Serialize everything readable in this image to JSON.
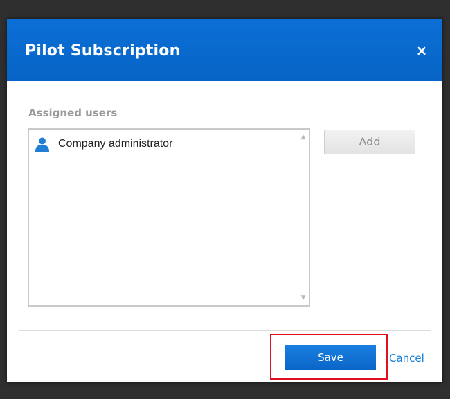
{
  "dialog": {
    "title": "Pilot Subscription",
    "close_icon": "close-icon",
    "close_glyph": "×",
    "header_color": "#0a6bd0"
  },
  "assigned_users": {
    "label": "Assigned users",
    "items": [
      {
        "label": "Company administrator",
        "icon": "user-icon"
      }
    ],
    "scroll_up_glyph": "▲",
    "scroll_down_glyph": "▼"
  },
  "actions": {
    "add_label": "Add",
    "save_label": "Save",
    "cancel_label": "Cancel",
    "save_color": "#0a6bd0",
    "highlight_color": "#e01020"
  }
}
